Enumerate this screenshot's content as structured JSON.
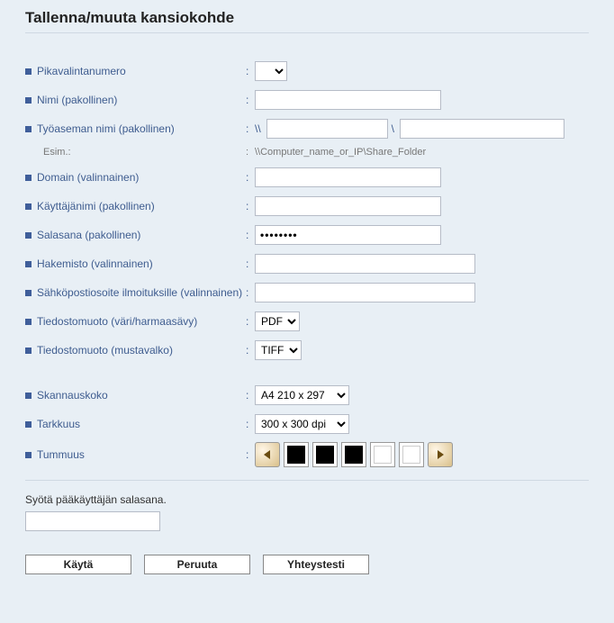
{
  "title": "Tallenna/muuta kansiokohde",
  "labels": {
    "quick": "Pikavalintanumero",
    "name": "Nimi (pakollinen)",
    "workstation": "Työaseman nimi (pakollinen)",
    "example": "Esim.:",
    "example_value": "\\\\Computer_name_or_IP\\Share_Folder",
    "domain": "Domain (valinnainen)",
    "username": "Käyttäjänimi (pakollinen)",
    "password": "Salasana (pakollinen)",
    "directory": "Hakemisto (valinnainen)",
    "email": "Sähköpostiosoite ilmoituksille (valinnainen)",
    "format_color": "Tiedostomuoto (väri/harmaasävy)",
    "format_bw": "Tiedostomuoto (mustavalko)",
    "scan_size": "Skannauskoko",
    "resolution": "Tarkkuus",
    "density": "Tummuus"
  },
  "values": {
    "password": "••••••••",
    "pdf": "PDF",
    "tiff": "TIFF",
    "a4": "A4 210 x 297",
    "dpi": "300 x 300 dpi"
  },
  "prefix": {
    "bs2": "\\\\",
    "bs1": "\\"
  },
  "admin": {
    "label": "Syötä pääkäyttäjän salasana."
  },
  "buttons": {
    "apply": "Käytä",
    "cancel": "Peruuta",
    "test": "Yhteystesti"
  }
}
